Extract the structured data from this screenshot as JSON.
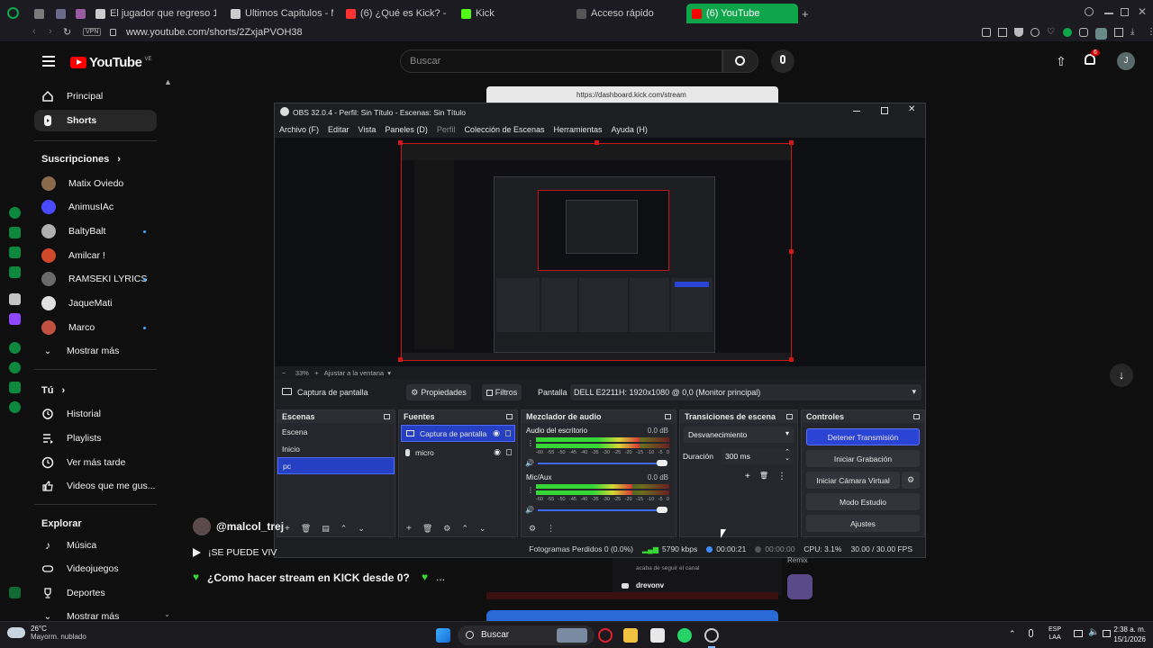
{
  "browser": {
    "tabs": [
      {
        "label": "",
        "color": "#9aa0a6"
      },
      {
        "label": "",
        "color": "#9aa0a6"
      },
      {
        "label": "",
        "color": "#9aa0a6"
      },
      {
        "label": "El jugador que regreso 10(",
        "color": "#d4d4d4"
      },
      {
        "label": "Ultimos Capitulos - Manh",
        "color": "#d4d4d4"
      },
      {
        "label": "(6) ¿Qué es Kick? - Gu",
        "color": "#ff3333"
      },
      {
        "label": "Kick",
        "color": "#53fc18"
      },
      {
        "label": "Acceso rápido",
        "color": "#9aa0a6"
      },
      {
        "label": "(6) YouTube",
        "color": "#ff0000"
      }
    ],
    "url": "www.youtube.com/shorts/2ZxjaPVOH38",
    "vpn_label": "VPN"
  },
  "youtube": {
    "logo_text": "YouTube",
    "logo_region": "VE",
    "search_placeholder": "Buscar",
    "notification_count": "6",
    "account_initial": "J",
    "sidebar": {
      "main": [
        {
          "label": "Principal",
          "icon": "home-icon"
        },
        {
          "label": "Shorts",
          "icon": "shorts-icon"
        }
      ],
      "subscriptions_header": "Suscripciones",
      "subscriptions": [
        {
          "label": "Matix Oviedo",
          "color": "#8a6a4a",
          "dot": false
        },
        {
          "label": "AnimusIAc",
          "color": "#4a4aff",
          "dot": false
        },
        {
          "label": "BaltyBalt",
          "color": "#b0b0b0",
          "dot": true
        },
        {
          "label": "Amilcar !",
          "color": "#d04a2a",
          "dot": false
        },
        {
          "label": "RAMSEKI LYRICS",
          "color": "#6a6a6a",
          "dot": true
        },
        {
          "label": "JaqueMati",
          "color": "#e0e0e0",
          "dot": false
        },
        {
          "label": "Marco",
          "color": "#c05040",
          "dot": true
        }
      ],
      "show_more": "Mostrar más",
      "you_header": "Tú",
      "you": [
        {
          "label": "Historial",
          "icon": "history-icon"
        },
        {
          "label": "Playlists",
          "icon": "playlist-icon"
        },
        {
          "label": "Ver más tarde",
          "icon": "clock-icon"
        },
        {
          "label": "Videos que me gus...",
          "icon": "like-icon"
        }
      ],
      "explore_header": "Explorar",
      "explore": [
        {
          "label": "Música",
          "icon": "music-icon"
        },
        {
          "label": "Videojuegos",
          "icon": "gamepad-icon"
        },
        {
          "label": "Deportes",
          "icon": "trophy-icon"
        },
        {
          "label": "Mostrar más",
          "icon": "chevron-down-icon"
        }
      ]
    },
    "short": {
      "channel": "@malcol_trej",
      "caption_partial": "¡SE PUEDE VIV",
      "title": "¿Como hacer stream en KICK desde 0?",
      "chat_user_1": "drevonv",
      "chat_text_1": "acaba de seguir el canal",
      "chat_label": "Remix"
    }
  },
  "obs": {
    "title": "OBS 32.0.4 - Perfil: Sin Título - Escenas: Sin Título",
    "menu": [
      "Archivo (F)",
      "Editar",
      "Vista",
      "Paneles (D)",
      "Perfil",
      "Colección de Escenas",
      "Herramientas",
      "Ayuda (H)"
    ],
    "zoom": "33%",
    "zoom_fit": "Ajustar a la ventana",
    "source_bar": {
      "source_name": "Captura de pantalla",
      "properties": "Propiedades",
      "filters": "Filtros",
      "screen_label": "Pantalla",
      "screen_value": "DELL E2211H: 1920x1080 @ 0,0 (Monitor principal)"
    },
    "scenes": {
      "title": "Escenas",
      "items": [
        "Escena",
        "Inicio",
        "pc"
      ],
      "selected": "pc"
    },
    "sources": {
      "title": "Fuentes",
      "items": [
        {
          "label": "Captura de pantalla",
          "icon": "monitor-icon",
          "selected": true
        },
        {
          "label": "micro",
          "icon": "microphone-icon",
          "selected": false
        }
      ]
    },
    "mixer": {
      "title": "Mezclador de audio",
      "channels": [
        {
          "name": "Audio del escritorio",
          "db": "0.0 dB",
          "level": 0.78
        },
        {
          "name": "Mic/Aux",
          "db": "0.0 dB",
          "level": 0.72
        }
      ],
      "scale": [
        "-60",
        "-55",
        "-50",
        "-45",
        "-40",
        "-35",
        "-30",
        "-25",
        "-20",
        "-15",
        "-10",
        "-5",
        "0"
      ]
    },
    "transitions": {
      "title": "Transiciones de escena",
      "type": "Desvanecimiento",
      "duration_label": "Duración",
      "duration_value": "300 ms"
    },
    "controls": {
      "title": "Controles",
      "buttons": [
        "Detener Transmisión",
        "Iniciar Grabación",
        "Iniciar Cámara Virtual",
        "Modo Estudio",
        "Ajustes"
      ]
    },
    "status": {
      "dropped": "Fotogramas Perdidos 0 (0.0%)",
      "bitrate": "5790 kbps",
      "live_time": "00:00:21",
      "rec_time": "00:00:00",
      "cpu": "CPU: 3.1%",
      "fps": "30.00 / 30.00 FPS"
    }
  },
  "taskbar": {
    "weather_temp": "26°C",
    "weather_desc": "Mayorm. nublado",
    "search_label": "Buscar",
    "lang_top": "ESP",
    "lang_bottom": "LAA",
    "time": "2:38 a. m.",
    "date": "15/1/2026"
  },
  "colors": {
    "accent_green": "#0fa64b",
    "obs_blue": "#2a44d6",
    "youtube_red": "#ff0000"
  }
}
